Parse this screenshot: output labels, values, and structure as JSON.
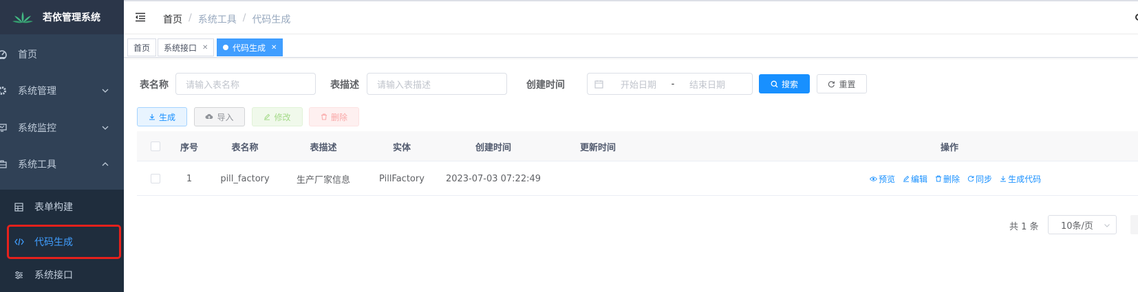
{
  "app": {
    "title": "若依管理系统"
  },
  "sidebar": {
    "items": [
      {
        "label": "首页",
        "icon": "dashboard-icon"
      },
      {
        "label": "系统管理",
        "icon": "gear-icon",
        "expanded": false
      },
      {
        "label": "系统监控",
        "icon": "monitor-icon",
        "expanded": false
      },
      {
        "label": "系统工具",
        "icon": "toolbox-icon",
        "expanded": true
      }
    ],
    "subitems": [
      {
        "label": "表单构建",
        "icon": "form-grid-icon"
      },
      {
        "label": "代码生成",
        "icon": "code-icon",
        "active": true
      },
      {
        "label": "系统接口",
        "icon": "sliders-icon"
      }
    ]
  },
  "breadcrumb": {
    "items": [
      "首页",
      "系统工具",
      "代码生成"
    ],
    "separator": "/"
  },
  "tags": [
    {
      "label": "首页",
      "closable": false
    },
    {
      "label": "系统接口",
      "closable": true
    },
    {
      "label": "代码生成",
      "closable": true,
      "active": true
    }
  ],
  "search": {
    "table_name_label": "表名称",
    "table_name_placeholder": "请输入表名称",
    "table_desc_label": "表描述",
    "table_desc_placeholder": "请输入表描述",
    "create_time_label": "创建时间",
    "start_placeholder": "开始日期",
    "range_separator": "-",
    "end_placeholder": "结束日期",
    "search_label": "搜索",
    "reset_label": "重置"
  },
  "toolbar": {
    "generate_label": "生成",
    "import_label": "导入",
    "edit_label": "修改",
    "delete_label": "删除"
  },
  "table": {
    "columns": [
      "序号",
      "表名称",
      "表描述",
      "实体",
      "创建时间",
      "更新时间",
      "操作"
    ],
    "rows": [
      {
        "index": "1",
        "table_name": "pill_factory",
        "table_desc": "生产厂家信息",
        "entity": "PillFactory",
        "create_time": "2023-07-03 07:22:49",
        "update_time": ""
      }
    ],
    "row_actions": [
      "预览",
      "编辑",
      "删除",
      "同步",
      "生成代码"
    ]
  },
  "pagination": {
    "total_text": "共 1 条",
    "page_size": "10条/页"
  },
  "colors": {
    "sidebar_bg": "#304156",
    "primary": "#1890ff",
    "active_menu": "#409eff",
    "highlight": "#e6211c"
  }
}
